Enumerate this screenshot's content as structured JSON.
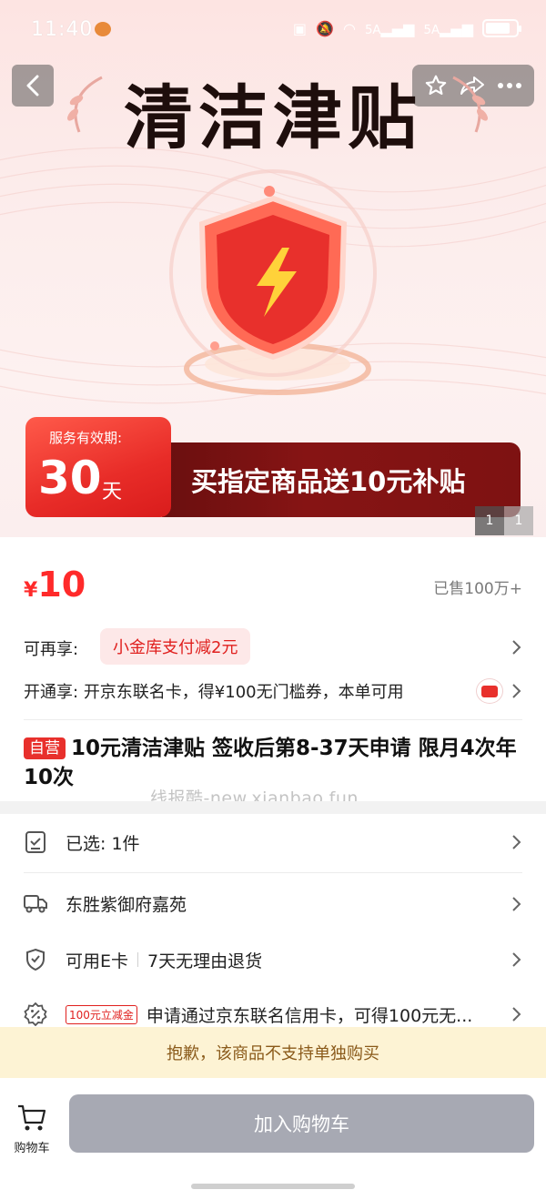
{
  "status_bar": {
    "time": "11:40",
    "signal1": "5A",
    "signal2": "5A"
  },
  "nav": {
    "back_icon": "chevron-left-icon",
    "fav_icon": "star-icon",
    "share_icon": "share-icon",
    "more_icon": "more-icon"
  },
  "hero": {
    "title": "清洁津贴",
    "banner_tag": "服务有效期:",
    "banner_number": "30",
    "banner_unit": "天",
    "banner_text": "买指定商品送10元补贴",
    "pager_current": "1",
    "pager_total": "1"
  },
  "price": {
    "symbol": "¥",
    "value": "10",
    "sold": "已售100万+"
  },
  "promo": {
    "label": "可再享:",
    "chip": "小金库支付减2元",
    "card_label": "开通享:",
    "card_text": "开京东联名卡，得¥100无门槛券，本单可用"
  },
  "product": {
    "tag": "自营",
    "title": "10元清洁津贴 签收后第8-37天申请 限月4次年10次",
    "watermark": "线报酷-new.xianbao.fun"
  },
  "details": {
    "selected": "已选: 1件",
    "address": "东胜紫御府嘉苑",
    "ecard": "可用E卡",
    "returns": "7天无理由退货",
    "coupon_tag": "100元立减金",
    "coupon_text": "申请通过京东联名信用卡，可得100元无..."
  },
  "notice": "抱歉，该商品不支持单独购买",
  "bottom": {
    "cart_label": "购物车",
    "add_to_cart": "加入购物车"
  },
  "colors": {
    "accent": "#e8302c",
    "price": "#ff2a2a",
    "button_disabled": "#a7a9b3",
    "notice_bg": "#fdf3d4"
  }
}
